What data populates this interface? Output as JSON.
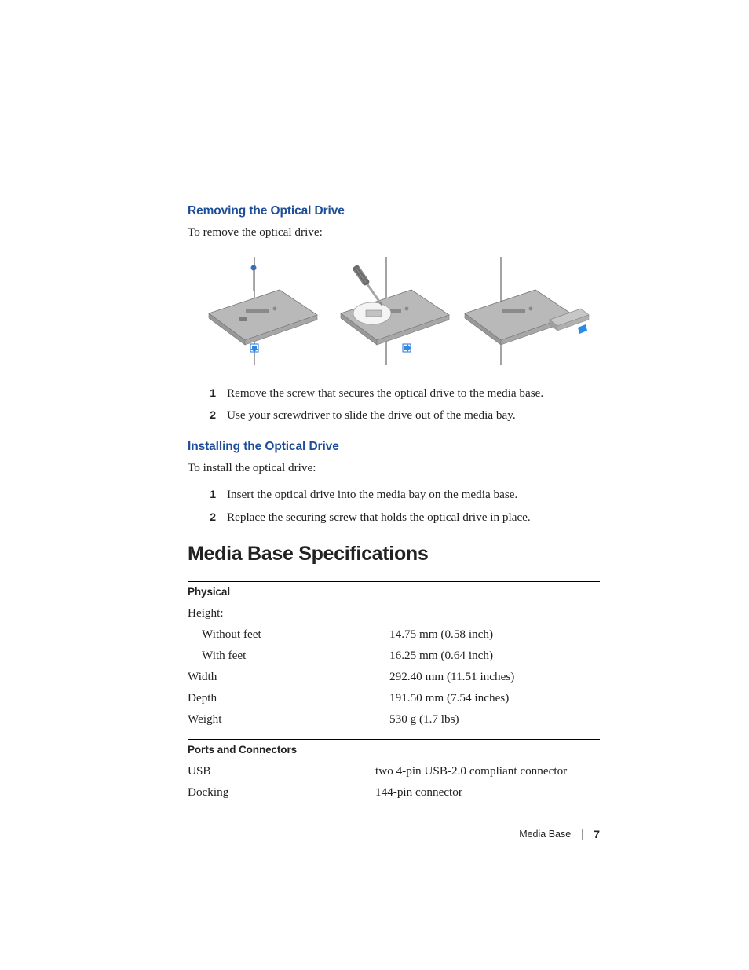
{
  "sections": {
    "removing": {
      "heading": "Removing the Optical Drive",
      "intro": "To remove the optical drive:",
      "steps": [
        "Remove the screw that secures the optical drive to the media base.",
        "Use your screwdriver to slide the drive out of the media bay."
      ]
    },
    "installing": {
      "heading": "Installing the Optical Drive",
      "intro": "To install the optical drive:",
      "steps": [
        "Insert the optical drive into the media bay on the media base.",
        "Replace the securing screw that holds the optical drive in place."
      ]
    }
  },
  "spec_heading": "Media Base Specifications",
  "spec_tables": {
    "physical": {
      "label": "Physical",
      "rows": {
        "height_label": "Height:",
        "without_feet_label": "Without feet",
        "without_feet_value": "14.75 mm (0.58 inch)",
        "with_feet_label": "With feet",
        "with_feet_value": "16.25 mm (0.64 inch)",
        "width_label": "Width",
        "width_value": "292.40 mm (11.51 inches)",
        "depth_label": "Depth",
        "depth_value": "191.50 mm (7.54 inches)",
        "weight_label": "Weight",
        "weight_value": "530 g (1.7 lbs)"
      }
    },
    "ports": {
      "label": "Ports and Connectors",
      "rows": {
        "usb_label": "USB",
        "usb_value": "two 4-pin USB-2.0 compliant connector",
        "docking_label": "Docking",
        "docking_value": "144-pin connector"
      }
    }
  },
  "step_numbers": {
    "one": "1",
    "two": "2"
  },
  "footer": {
    "title": "Media Base",
    "page": "7"
  }
}
